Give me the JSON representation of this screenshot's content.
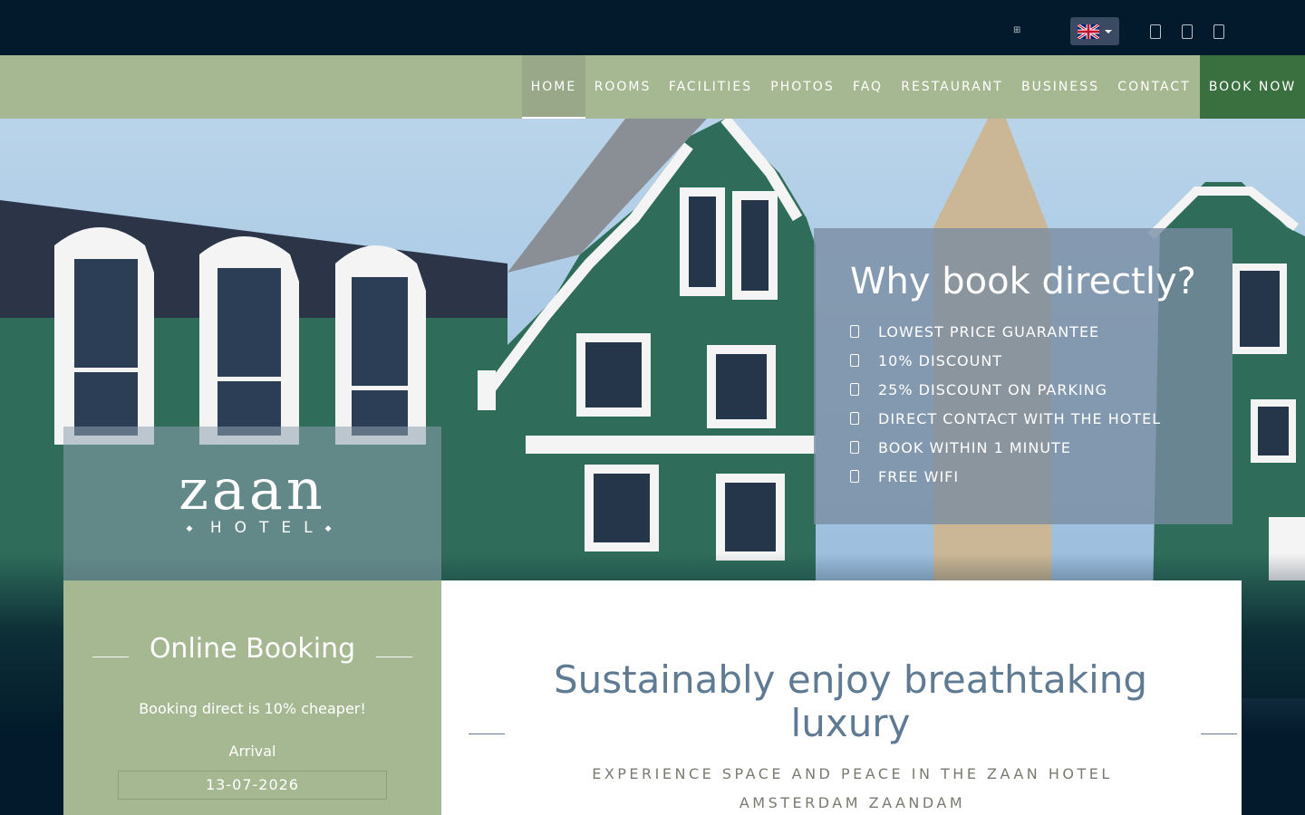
{
  "topbar": {
    "grid_icon": "⊞",
    "language": {
      "selected": "English",
      "flag_icon": "uk-flag-icon"
    },
    "social_icons": [
      "facebook-icon",
      "instagram-icon",
      "linkedin-icon"
    ]
  },
  "nav": {
    "items": [
      {
        "label": "HOME",
        "active": true
      },
      {
        "label": "ROOMS"
      },
      {
        "label": "FACILITIES"
      },
      {
        "label": "PHOTOS"
      },
      {
        "label": "FAQ"
      },
      {
        "label": "RESTAURANT"
      },
      {
        "label": "BUSINESS"
      },
      {
        "label": "CONTACT"
      }
    ],
    "book_now": "BOOK NOW"
  },
  "why_book": {
    "title": "Why book directly?",
    "items": [
      "LOWEST PRICE GUARANTEE",
      "10% DISCOUNT",
      "25% DISCOUNT ON PARKING",
      "DIRECT CONTACT WITH THE HOTEL",
      "BOOK WITHIN 1 MINUTE",
      "FREE WIFI"
    ]
  },
  "logo": {
    "word": "zaan",
    "sub": "HOTEL"
  },
  "booking": {
    "title": "Online Booking",
    "promo": "Booking direct is 10% cheaper!",
    "arrival_label": "Arrival",
    "arrival_value": "13-07-2026"
  },
  "main": {
    "headline": "Sustainably enjoy breathtaking luxury",
    "subheadline": "EXPERIENCE SPACE AND PEACE IN THE ZAAN HOTEL AMSTERDAM ZAANDAM"
  },
  "colors": {
    "topbar": "#021a2b",
    "nav": "#a6b891",
    "book_now": "#3a6f3f",
    "headline": "#5f7a93"
  }
}
